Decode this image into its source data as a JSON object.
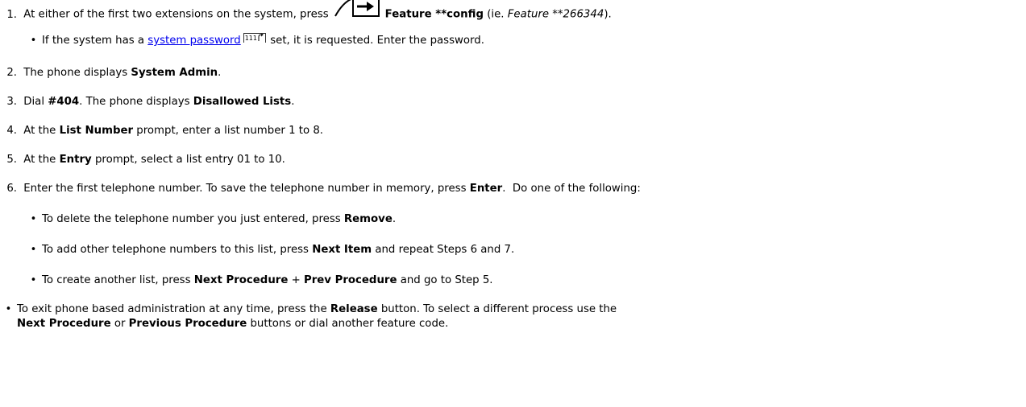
{
  "steps": [
    {
      "num": "1.",
      "a": "At either of the first two extensions on the system, press",
      "b1": "Feature **config",
      "c": " (ie. ",
      "i": "Feature **266344",
      "d": ")."
    },
    {
      "num": "2.",
      "a": "The phone displays ",
      "b1": "System Admin",
      "c": "."
    },
    {
      "num": "3.",
      "a": "Dial ",
      "b1": "#404",
      "c": ". The phone displays ",
      "b2": "Disallowed Lists",
      "d": "."
    },
    {
      "num": "4.",
      "a": "At the ",
      "b1": "List Number",
      "c": " prompt, enter a list number 1 to 8."
    },
    {
      "num": "5.",
      "a": "At the ",
      "b1": "Entry",
      "c": " prompt, select a list entry 01 to 10."
    },
    {
      "num": "6.",
      "a": "Enter the first telephone number. To save the telephone number in memory, press ",
      "b1": "Enter",
      "c": ".  Do one of the following:"
    }
  ],
  "step1_sub": {
    "a": "If the system has a ",
    "link": "system password",
    "ref": "111",
    "b": " set, it is requested. Enter the password."
  },
  "step6_subs": [
    {
      "a": "To delete the telephone number you just entered, press ",
      "b1": "Remove",
      "c": "."
    },
    {
      "a": "To add other telephone numbers to this list, press ",
      "b1": "Next Item",
      "c": " and repeat Steps 6 and 7."
    },
    {
      "a": "To create another list, press ",
      "b1": "Next Procedure",
      "c": " + ",
      "b2": "Prev Procedure",
      "d": " and go to Step 5."
    }
  ],
  "final_note": {
    "a": "To exit phone based administration at any time, press the ",
    "b1": "Release",
    "c": " button. To select a different process use the",
    "b2": "Next Procedure",
    "d": " or ",
    "b3": "Previous Procedure",
    "e": " buttons or dial another feature code."
  },
  "icons": {
    "feature_key": "feature-key-icon",
    "xref": "cross-reference-icon"
  }
}
